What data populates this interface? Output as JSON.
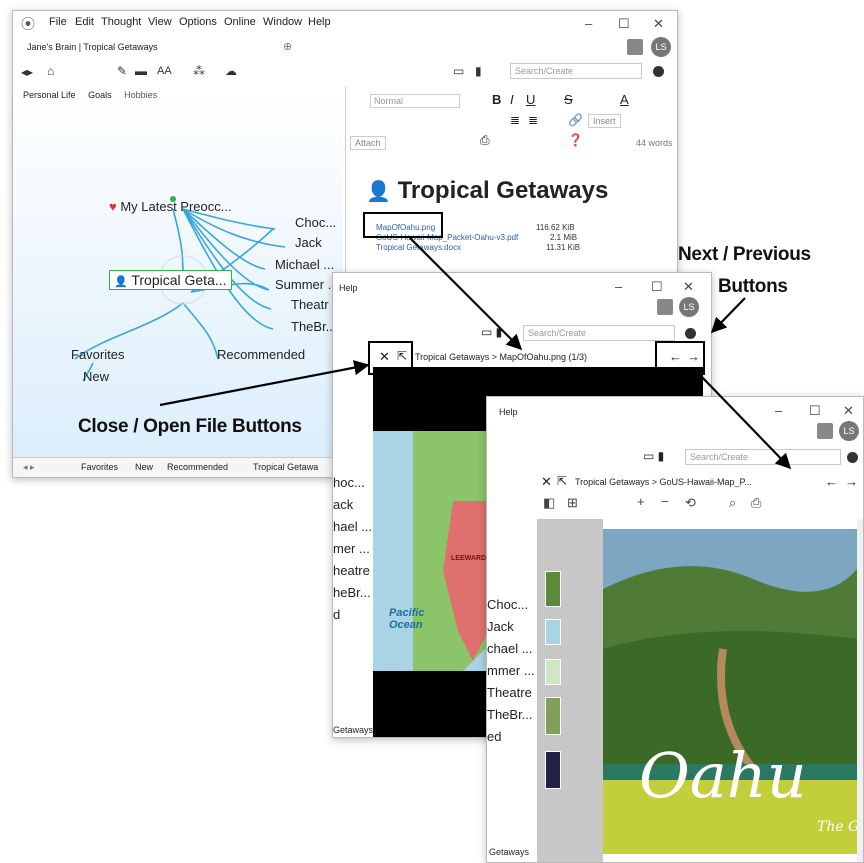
{
  "main": {
    "menu": [
      "File",
      "Edit",
      "Thought",
      "View",
      "Options",
      "Online",
      "Window",
      "Help"
    ],
    "brain_tab": "Jane's Brain | Tropical Getaways",
    "search_placeholder": "Search/Create",
    "avatar": "LS",
    "tags": [
      "Personal Life",
      "Goals",
      "Hobbies"
    ],
    "nodes": {
      "parent": "My Latest Preocc...",
      "active": "Tropical Geta...",
      "children": [
        "Choc...",
        "Jack",
        "Michael ...",
        "Summer ...",
        "Theatr",
        "TheBr..."
      ],
      "bottom": [
        "Favorites",
        "Recommended",
        "New"
      ]
    },
    "breadcrumbs": [
      "Favorites",
      "New",
      "Recommended",
      "Tropical Getawa"
    ],
    "editor": {
      "style": "Normal",
      "insert": "Insert",
      "attach": "Attach",
      "words": "44 words",
      "title": "Tropical Getaways",
      "files": [
        {
          "name": "MapOfOahu.png",
          "size": "116.62 KiB"
        },
        {
          "name": "GoUS-Hawaii-Map_Packet-Oahu-v3.pdf",
          "size": "2.1 MiB"
        },
        {
          "name": "Tropical Getaways.docx",
          "size": "11.31 KiB"
        }
      ]
    }
  },
  "win2": {
    "menu": "Help",
    "search_placeholder": "Search/Create",
    "avatar": "LS",
    "path": "Tropical Getaways > MapOfOahu.png (1/3)",
    "nodes": [
      "hoc...",
      "ack",
      "hael ...",
      "mer ...",
      "heatre",
      "heBr...",
      "d"
    ],
    "breadcrumb": "Getaways",
    "map": {
      "region": "LEEWARD COAST",
      "ocean": "Pacific Ocean"
    }
  },
  "win3": {
    "menu": "Help",
    "search_placeholder": "Search/Create",
    "avatar": "LS",
    "path": "Tropical Getaways > GoUS-Hawaii-Map_P...",
    "nodes": [
      "Choc...",
      "Jack",
      "chael ...",
      "mmer ...",
      "Theatre",
      "TheBr...",
      "ed"
    ],
    "breadcrumb": "Getaways",
    "cover_title": "Oahu",
    "cover_subtitle": "The Gat"
  },
  "callouts": {
    "next_prev": [
      "Next / Previous",
      "Buttons"
    ],
    "close_open": "Close / Open File Buttons"
  },
  "colors": {
    "accent": "#39a7d6",
    "link": "#2b5db5",
    "map_red": "#e0706e",
    "map_green": "#8cc46a",
    "ocean": "#a8d4e6"
  }
}
